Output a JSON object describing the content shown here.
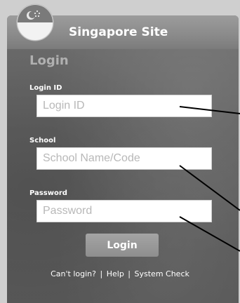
{
  "header": {
    "title": "Singapore Site",
    "logo_icon": "singapore-flag-icon"
  },
  "login": {
    "heading": "Login",
    "login_id_label": "Login ID",
    "login_id_placeholder": "Login ID",
    "school_label": "School",
    "school_placeholder": "School Name/Code",
    "password_label": "Password",
    "password_placeholder": "Password",
    "submit_label": "Login"
  },
  "footer": {
    "cant_login": "Can't login?",
    "help": "Help",
    "system_check": "System Check",
    "separator": "|"
  },
  "colors": {
    "panel": "#5f5f5f",
    "header": "#8a8a8a",
    "button": "#9a9a9a",
    "text": "#ffffff"
  }
}
